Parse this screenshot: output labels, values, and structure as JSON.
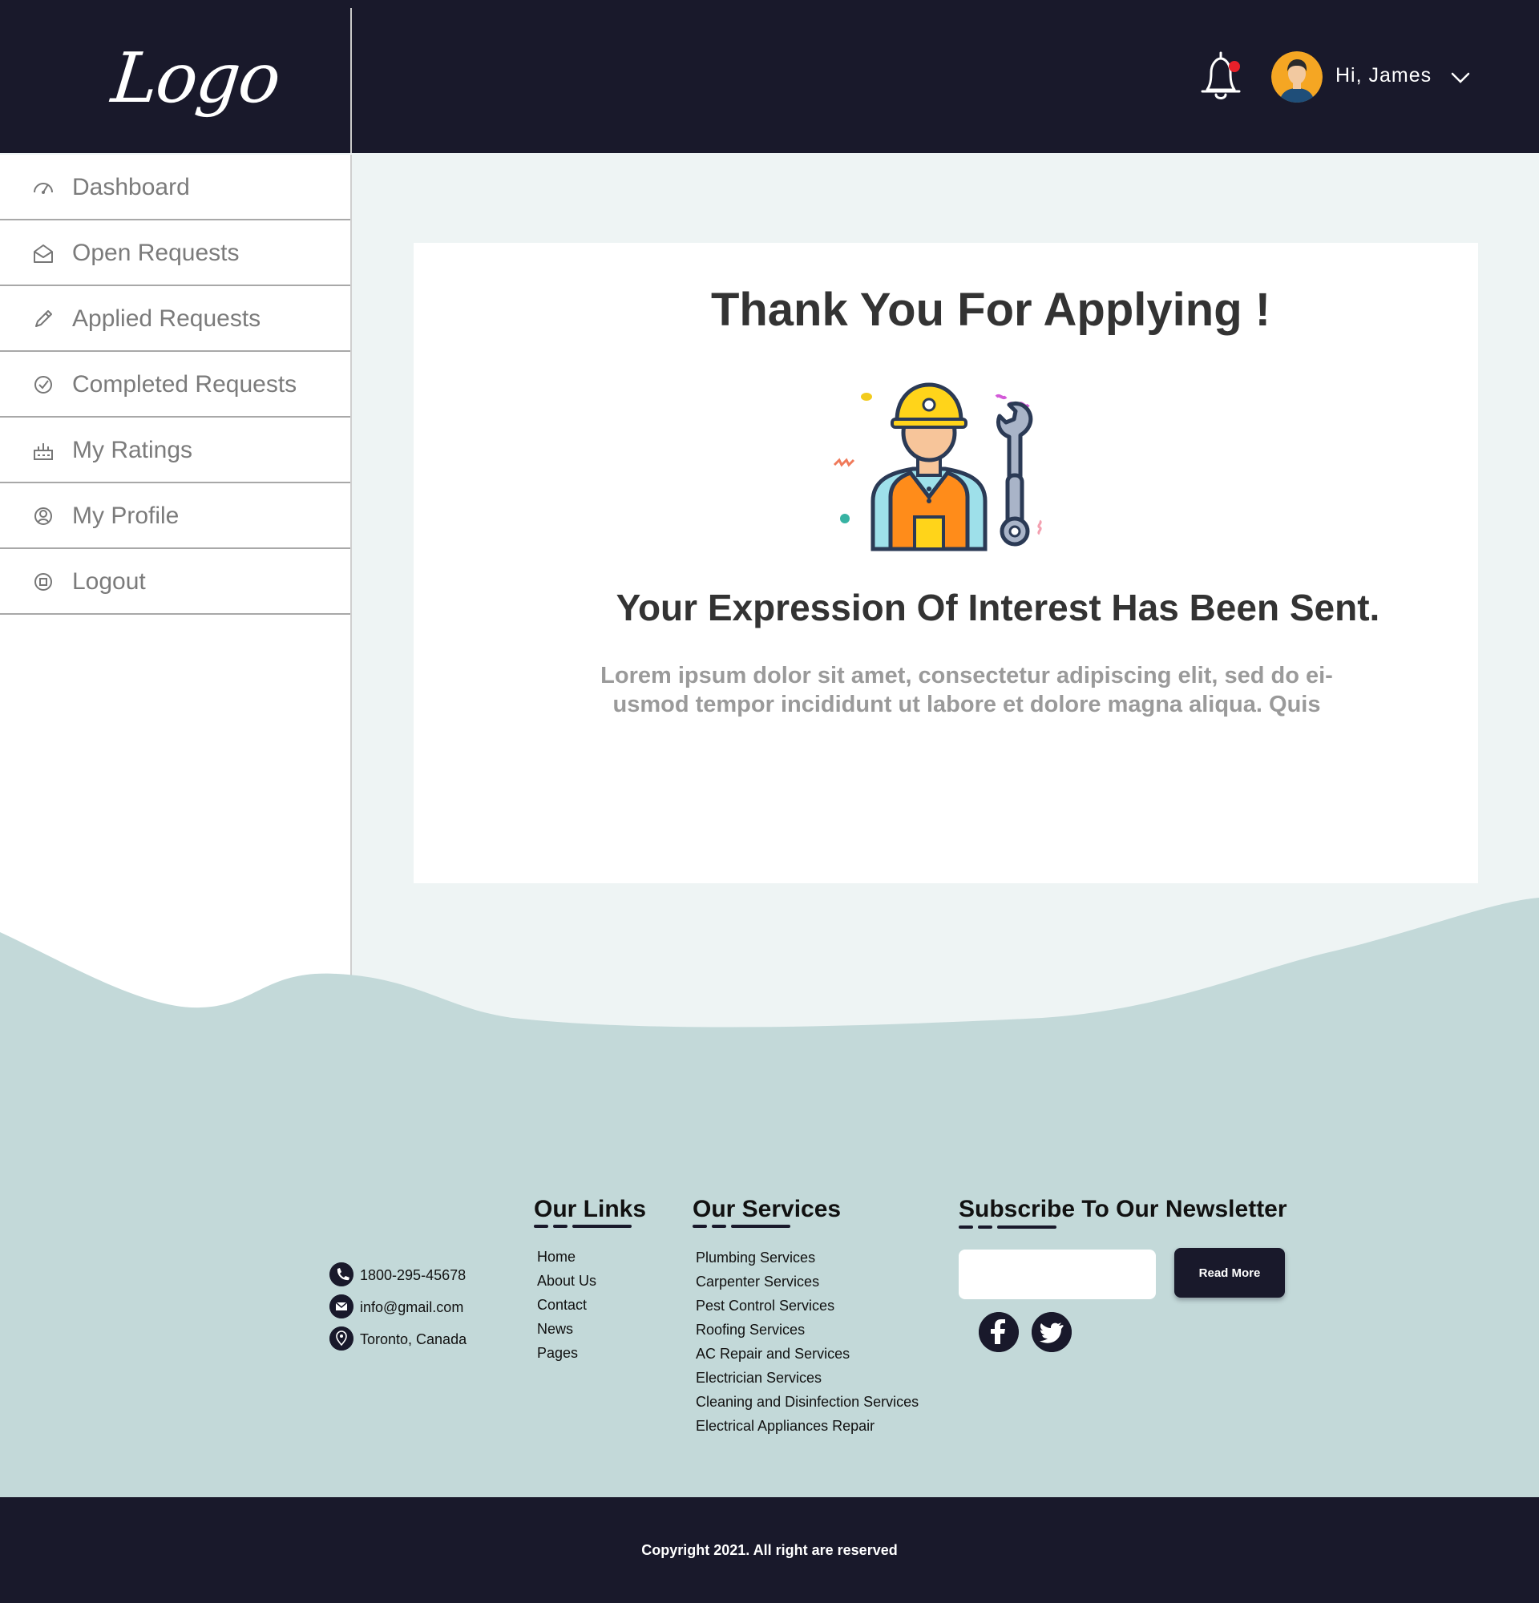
{
  "header": {
    "logo": "Logo",
    "greeting": "Hi, James",
    "icons": {
      "notification": "bell-icon",
      "menu": "chevron-down-icon"
    },
    "notification_dot_color": "#e8202a",
    "bg_color": "#19192b"
  },
  "sidebar": {
    "items": [
      {
        "label": "Dashboard",
        "icon": "speedometer-icon"
      },
      {
        "label": "Open Requests",
        "icon": "envelope-open-icon"
      },
      {
        "label": "Applied Requests",
        "icon": "pencil-icon"
      },
      {
        "label": "Completed Requests",
        "icon": "check-circle-icon"
      },
      {
        "label": "My Ratings",
        "icon": "ratings-icon"
      },
      {
        "label": "My Profile",
        "icon": "user-circle-icon"
      },
      {
        "label": "Logout",
        "icon": "logout-icon"
      }
    ]
  },
  "main": {
    "title": "Thank You For Applying !",
    "illustration": "worker-with-wrench-icon",
    "subtitle": "Your Expression Of Interest Has Been Sent.",
    "body_line1": "Lorem ipsum dolor sit amet, consectetur adipiscing elit, sed do ei-",
    "body_line2": "usmod tempor incididunt ut labore et dolore magna aliqua. Quis"
  },
  "footer": {
    "contact": {
      "phone": "1800-295-45678",
      "email": "info@gmail.com",
      "location": "Toronto, Canada"
    },
    "links": {
      "heading": "Our Links",
      "items": [
        "Home",
        "About Us",
        "Contact",
        "News",
        "Pages"
      ]
    },
    "services": {
      "heading": "Our Services",
      "items": [
        "Plumbing Services",
        "Carpenter Services",
        "Pest Control Services",
        "Roofing Services",
        "AC Repair and Services",
        "Electrician Services",
        "Cleaning and Disinfection Services",
        "Electrical Appliances Repair"
      ]
    },
    "newsletter": {
      "heading": "Subscribe To Our Newsletter",
      "input_value": "",
      "button_label": "Read More",
      "social": [
        "facebook-icon",
        "twitter-icon"
      ]
    },
    "copyright": "Copyright 2021. All right are reserved"
  }
}
